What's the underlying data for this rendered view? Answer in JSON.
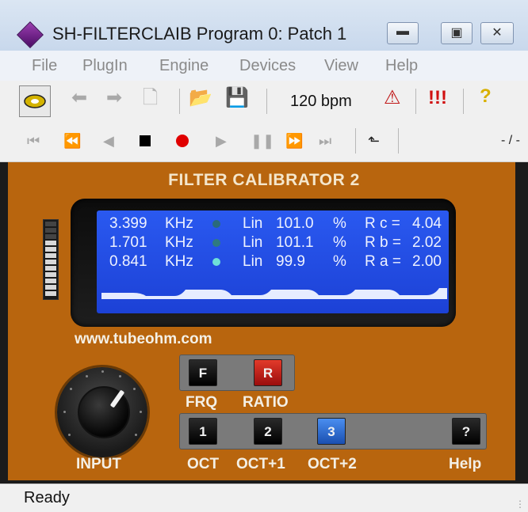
{
  "window": {
    "title": "SH-FILTERCLAIB Program 0: Patch 1",
    "buttons": [
      "minimize",
      "maximize",
      "close"
    ]
  },
  "menu": [
    "File",
    "PlugIn",
    "Engine",
    "Devices",
    "View",
    "Help"
  ],
  "toolbar": {
    "bpm": "120 bpm",
    "icons": [
      "plugin-settings-icon",
      "back-arrow-icon",
      "forward-arrow-icon",
      "copy-icon",
      "open-folder-icon",
      "save-disk-icon",
      "metronome-icon",
      "panic-icon",
      "help-icon"
    ]
  },
  "transport": {
    "icons": [
      "to-start-icon",
      "rewind-icon",
      "step-back-icon",
      "stop-icon",
      "record-icon",
      "play-icon",
      "pause-icon",
      "fast-forward-icon",
      "to-end-icon",
      "loop-icon"
    ],
    "position": "- / -"
  },
  "plugin": {
    "title": "FILTER CALIBRATOR 2",
    "url": "www.tubeohm.com",
    "level_meter": {
      "lit_segments": 9,
      "total_segments": 12
    },
    "display_rows": [
      {
        "freq": "3.399",
        "unit": "KHz",
        "mode": "Lin",
        "percent": "101.0",
        "pct_sign": "%",
        "ratio_label": "R c =",
        "ratio_value": "4.04",
        "led": "#2a6a7a"
      },
      {
        "freq": "1.701",
        "unit": "KHz",
        "mode": "Lin",
        "percent": "101.1",
        "pct_sign": "%",
        "ratio_label": "R b =",
        "ratio_value": "2.02",
        "led": "#2f7a80"
      },
      {
        "freq": "0.841",
        "unit": "KHz",
        "mode": "Lin",
        "percent": "99.9",
        "pct_sign": "%",
        "ratio_label": "R a =",
        "ratio_value": "2.00",
        "led": "#6fe0d8"
      }
    ],
    "knob_label": "INPUT",
    "mode_buttons": [
      {
        "key": "F",
        "label": "FRQ",
        "color": "black"
      },
      {
        "key": "R",
        "label": "RATIO",
        "color": "red"
      }
    ],
    "octave_buttons": [
      {
        "key": "1",
        "label": "OCT",
        "color": "black"
      },
      {
        "key": "2",
        "label": "OCT+1",
        "color": "black"
      },
      {
        "key": "3",
        "label": "OCT+2",
        "color": "blue"
      }
    ],
    "help_button": {
      "key": "?",
      "label": "Help"
    }
  },
  "status": {
    "text": "Ready"
  }
}
